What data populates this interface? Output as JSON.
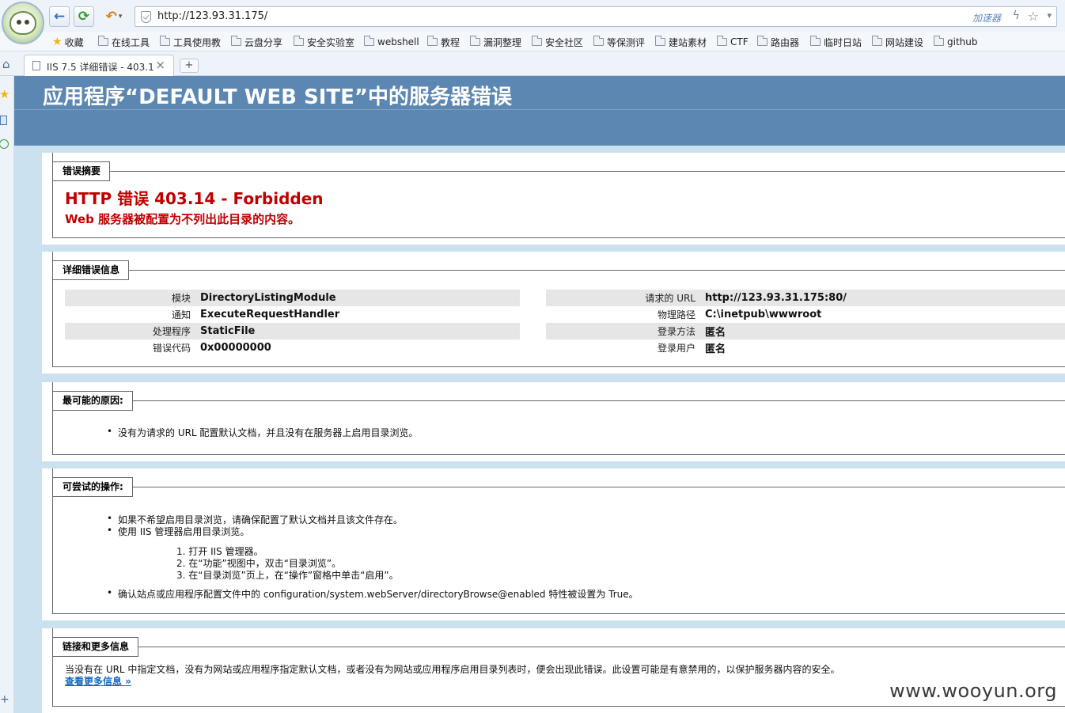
{
  "browser": {
    "url": "http://123.93.31.175/",
    "accelerator_label": "加速器",
    "icons": {
      "back": "back-arrow-icon",
      "refresh": "refresh-icon",
      "undo": "undo-icon",
      "shield": "shield-icon",
      "bolt": "bolt-icon",
      "star": "star-icon",
      "home": "home-icon"
    },
    "bookmarks": [
      {
        "label": "收藏",
        "icon": "star-icon"
      },
      {
        "label": "在线工具",
        "icon": "folder-icon"
      },
      {
        "label": "工具使用教",
        "icon": "folder-icon"
      },
      {
        "label": "云盘分享",
        "icon": "folder-icon"
      },
      {
        "label": "安全实验室",
        "icon": "folder-icon"
      },
      {
        "label": "webshell",
        "icon": "folder-icon"
      },
      {
        "label": "教程",
        "icon": "folder-icon"
      },
      {
        "label": "漏洞整理",
        "icon": "folder-icon"
      },
      {
        "label": "安全社区",
        "icon": "folder-icon"
      },
      {
        "label": "等保测评",
        "icon": "folder-icon"
      },
      {
        "label": "建站素材",
        "icon": "folder-icon"
      },
      {
        "label": "CTF",
        "icon": "folder-icon"
      },
      {
        "label": "路由器",
        "icon": "folder-icon"
      },
      {
        "label": "临时日站",
        "icon": "folder-icon"
      },
      {
        "label": "网站建设",
        "icon": "folder-icon"
      },
      {
        "label": "github",
        "icon": "folder-icon"
      }
    ],
    "tab": {
      "title": "IIS 7.5 详细错误 - 403.1",
      "close": "×"
    },
    "new_tab": "+"
  },
  "page": {
    "header_title": "应用程序“DEFAULT WEB SITE”中的服务器错误",
    "summary": {
      "legend": "错误摘要",
      "title": "HTTP 错误 403.14 - Forbidden",
      "description": "Web 服务器被配置为不列出此目录的内容。"
    },
    "details": {
      "legend": "详细错误信息",
      "left": [
        {
          "key": "模块",
          "value": "DirectoryListingModule"
        },
        {
          "key": "通知",
          "value": "ExecuteRequestHandler"
        },
        {
          "key": "处理程序",
          "value": "StaticFile"
        },
        {
          "key": "错误代码",
          "value": "0x00000000"
        }
      ],
      "right": [
        {
          "key": "请求的 URL",
          "value": "http://123.93.31.175:80/"
        },
        {
          "key": "物理路径",
          "value": "C:\\inetpub\\wwwroot"
        },
        {
          "key": "登录方法",
          "value": "匿名"
        },
        {
          "key": "登录用户",
          "value": "匿名"
        }
      ]
    },
    "causes": {
      "legend": "最可能的原因:",
      "items": [
        "没有为请求的 URL 配置默认文档，并且没有在服务器上启用目录浏览。"
      ]
    },
    "actions": {
      "legend": "可尝试的操作:",
      "items": [
        "如果不希望启用目录浏览，请确保配置了默认文档并且该文件存在。",
        "使用 IIS 管理器启用目录浏览。"
      ],
      "steps": [
        "1.  打开 IIS 管理器。",
        "2.  在“功能”视图中，双击“目录浏览”。",
        "3.  在“目录浏览”页上，在“操作”窗格中单击“启用”。"
      ],
      "last_item": "确认站点或应用程序配置文件中的 configuration/system.webServer/directoryBrowse@enabled 特性被设置为 True。"
    },
    "more": {
      "legend": "链接和更多信息",
      "text": "当没有在 URL 中指定文档，没有为网站或应用程序指定默认文档，或者没有为网站或应用程序启用目录列表时，便会出现此错误。此设置可能是有意禁用的，以保护服务器内容的安全。",
      "link": "查看更多信息 »"
    }
  },
  "watermark": "www.wooyun.org",
  "colors": {
    "header_band": "#5c87b2",
    "page_bg": "#cbe1ef",
    "error_red": "#c00000",
    "link_blue": "#1565c0"
  }
}
